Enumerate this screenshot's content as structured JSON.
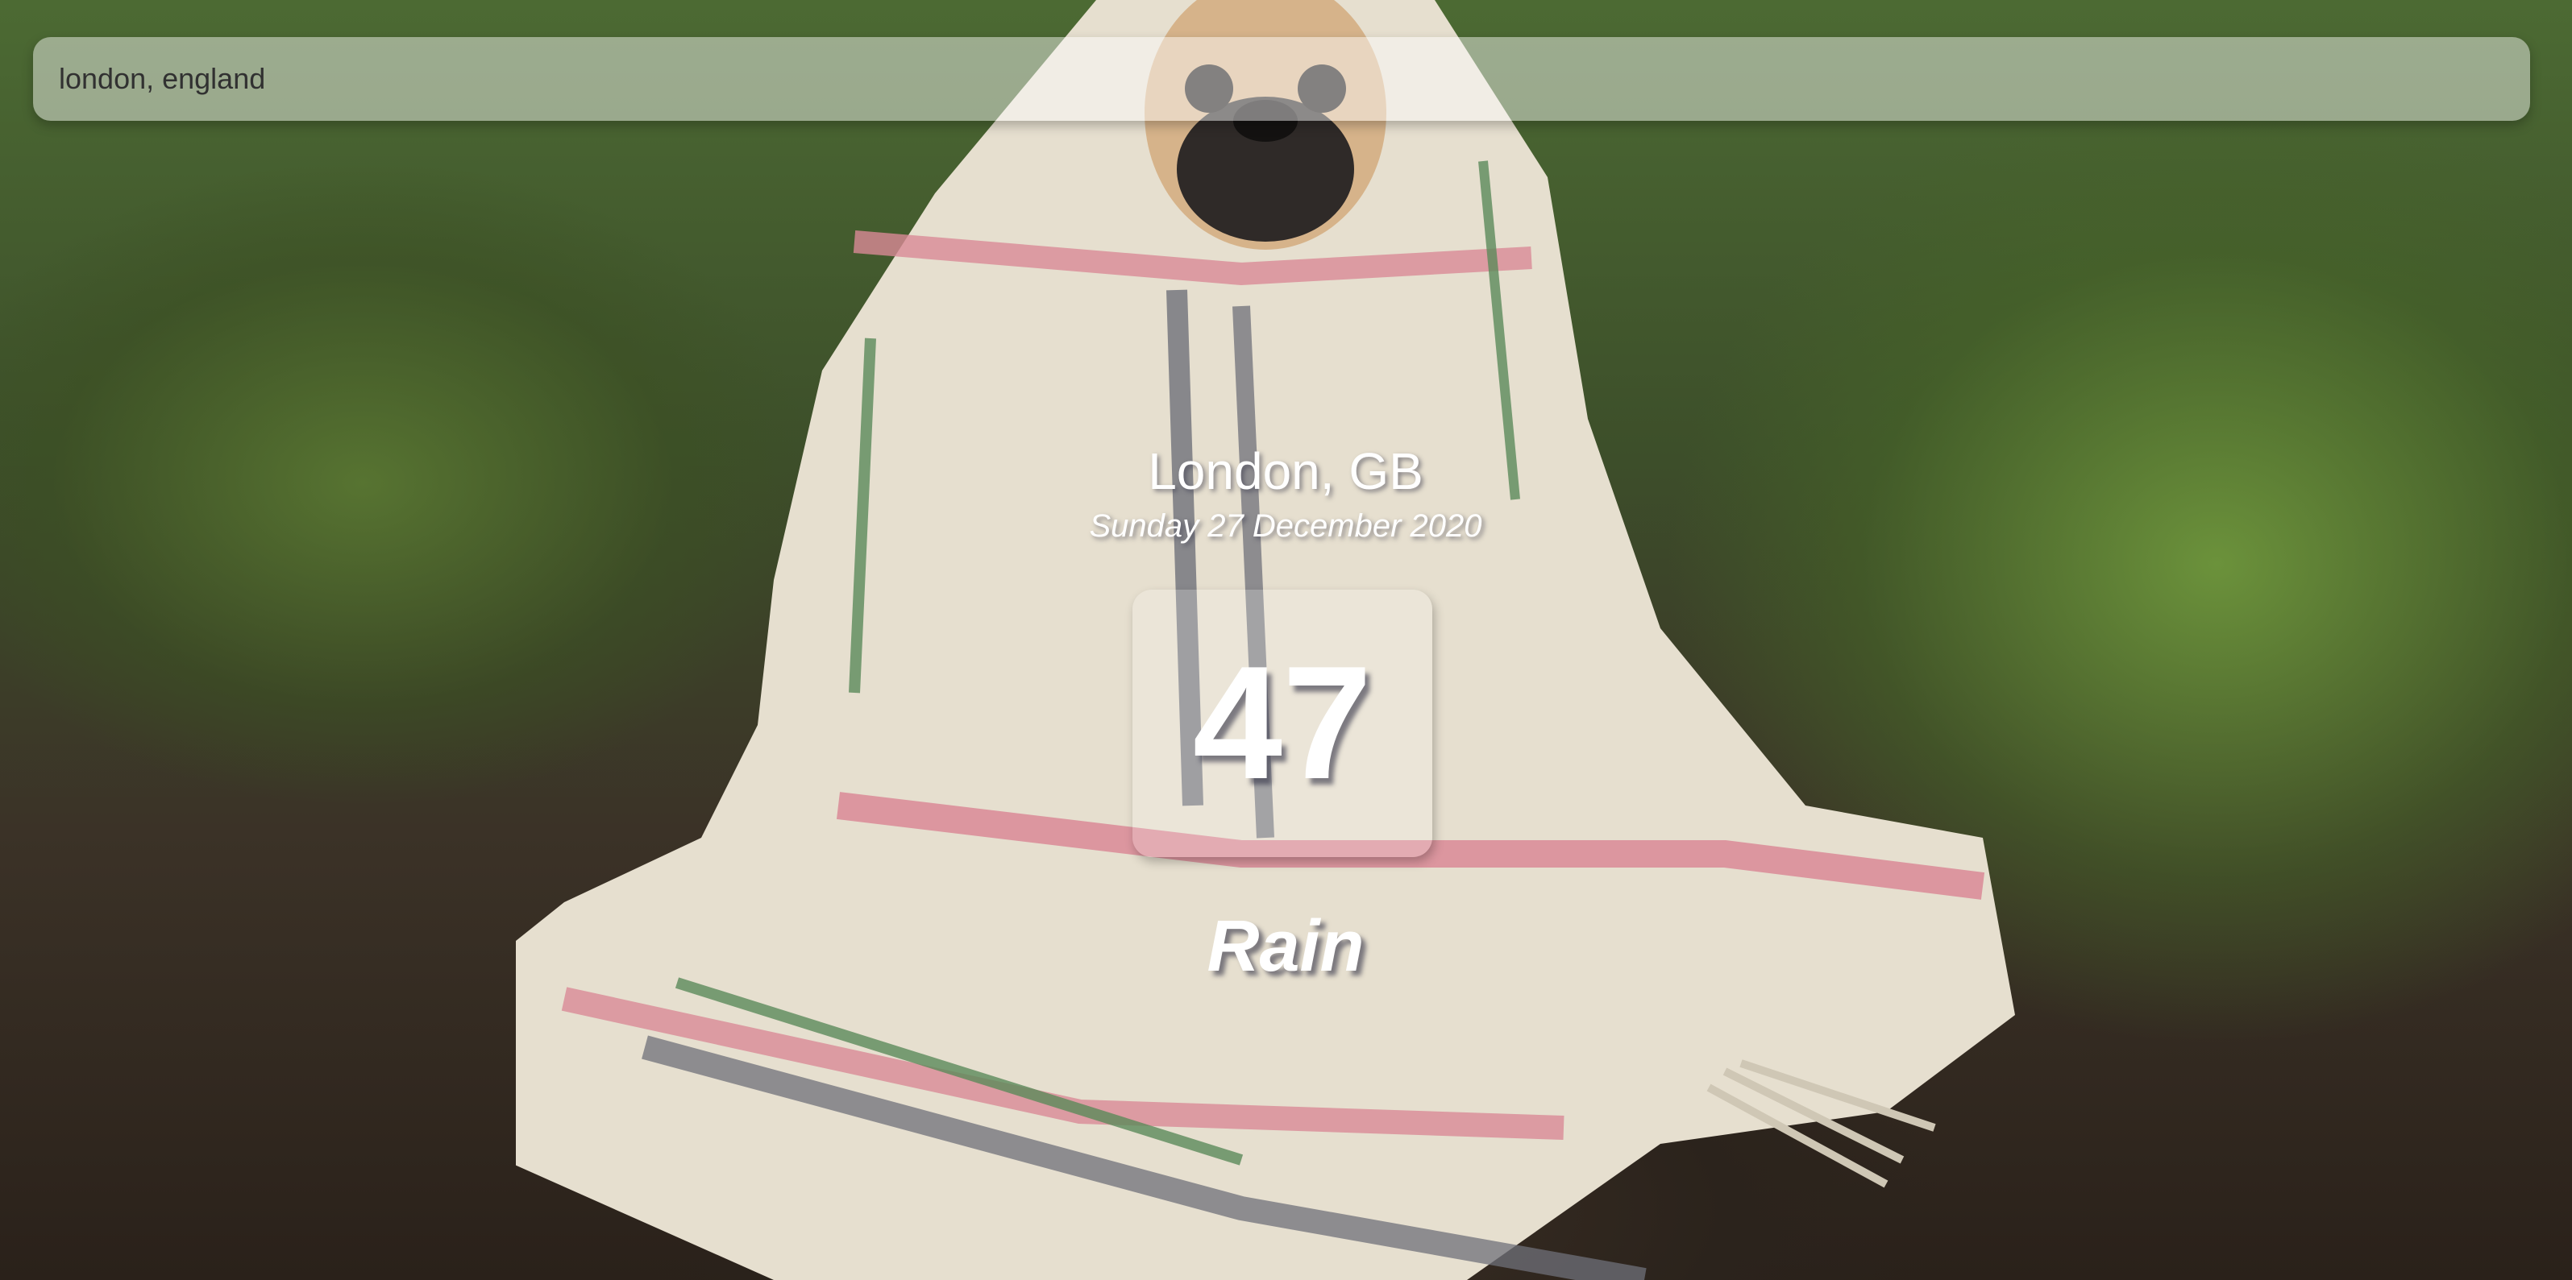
{
  "search": {
    "value": "london, england"
  },
  "location": {
    "city": "London, GB",
    "date": "Sunday 27 December 2020"
  },
  "weather": {
    "temperature": "47",
    "condition": "Rain"
  },
  "background": {
    "description_colors": {
      "foliage": "#4c6a33",
      "ground": "#2a211a",
      "blanket": "#e6dfcf",
      "stripe_pink": "#d98a96",
      "stripe_green": "#5b8a5a",
      "stripe_gray": "#6f7079"
    }
  }
}
